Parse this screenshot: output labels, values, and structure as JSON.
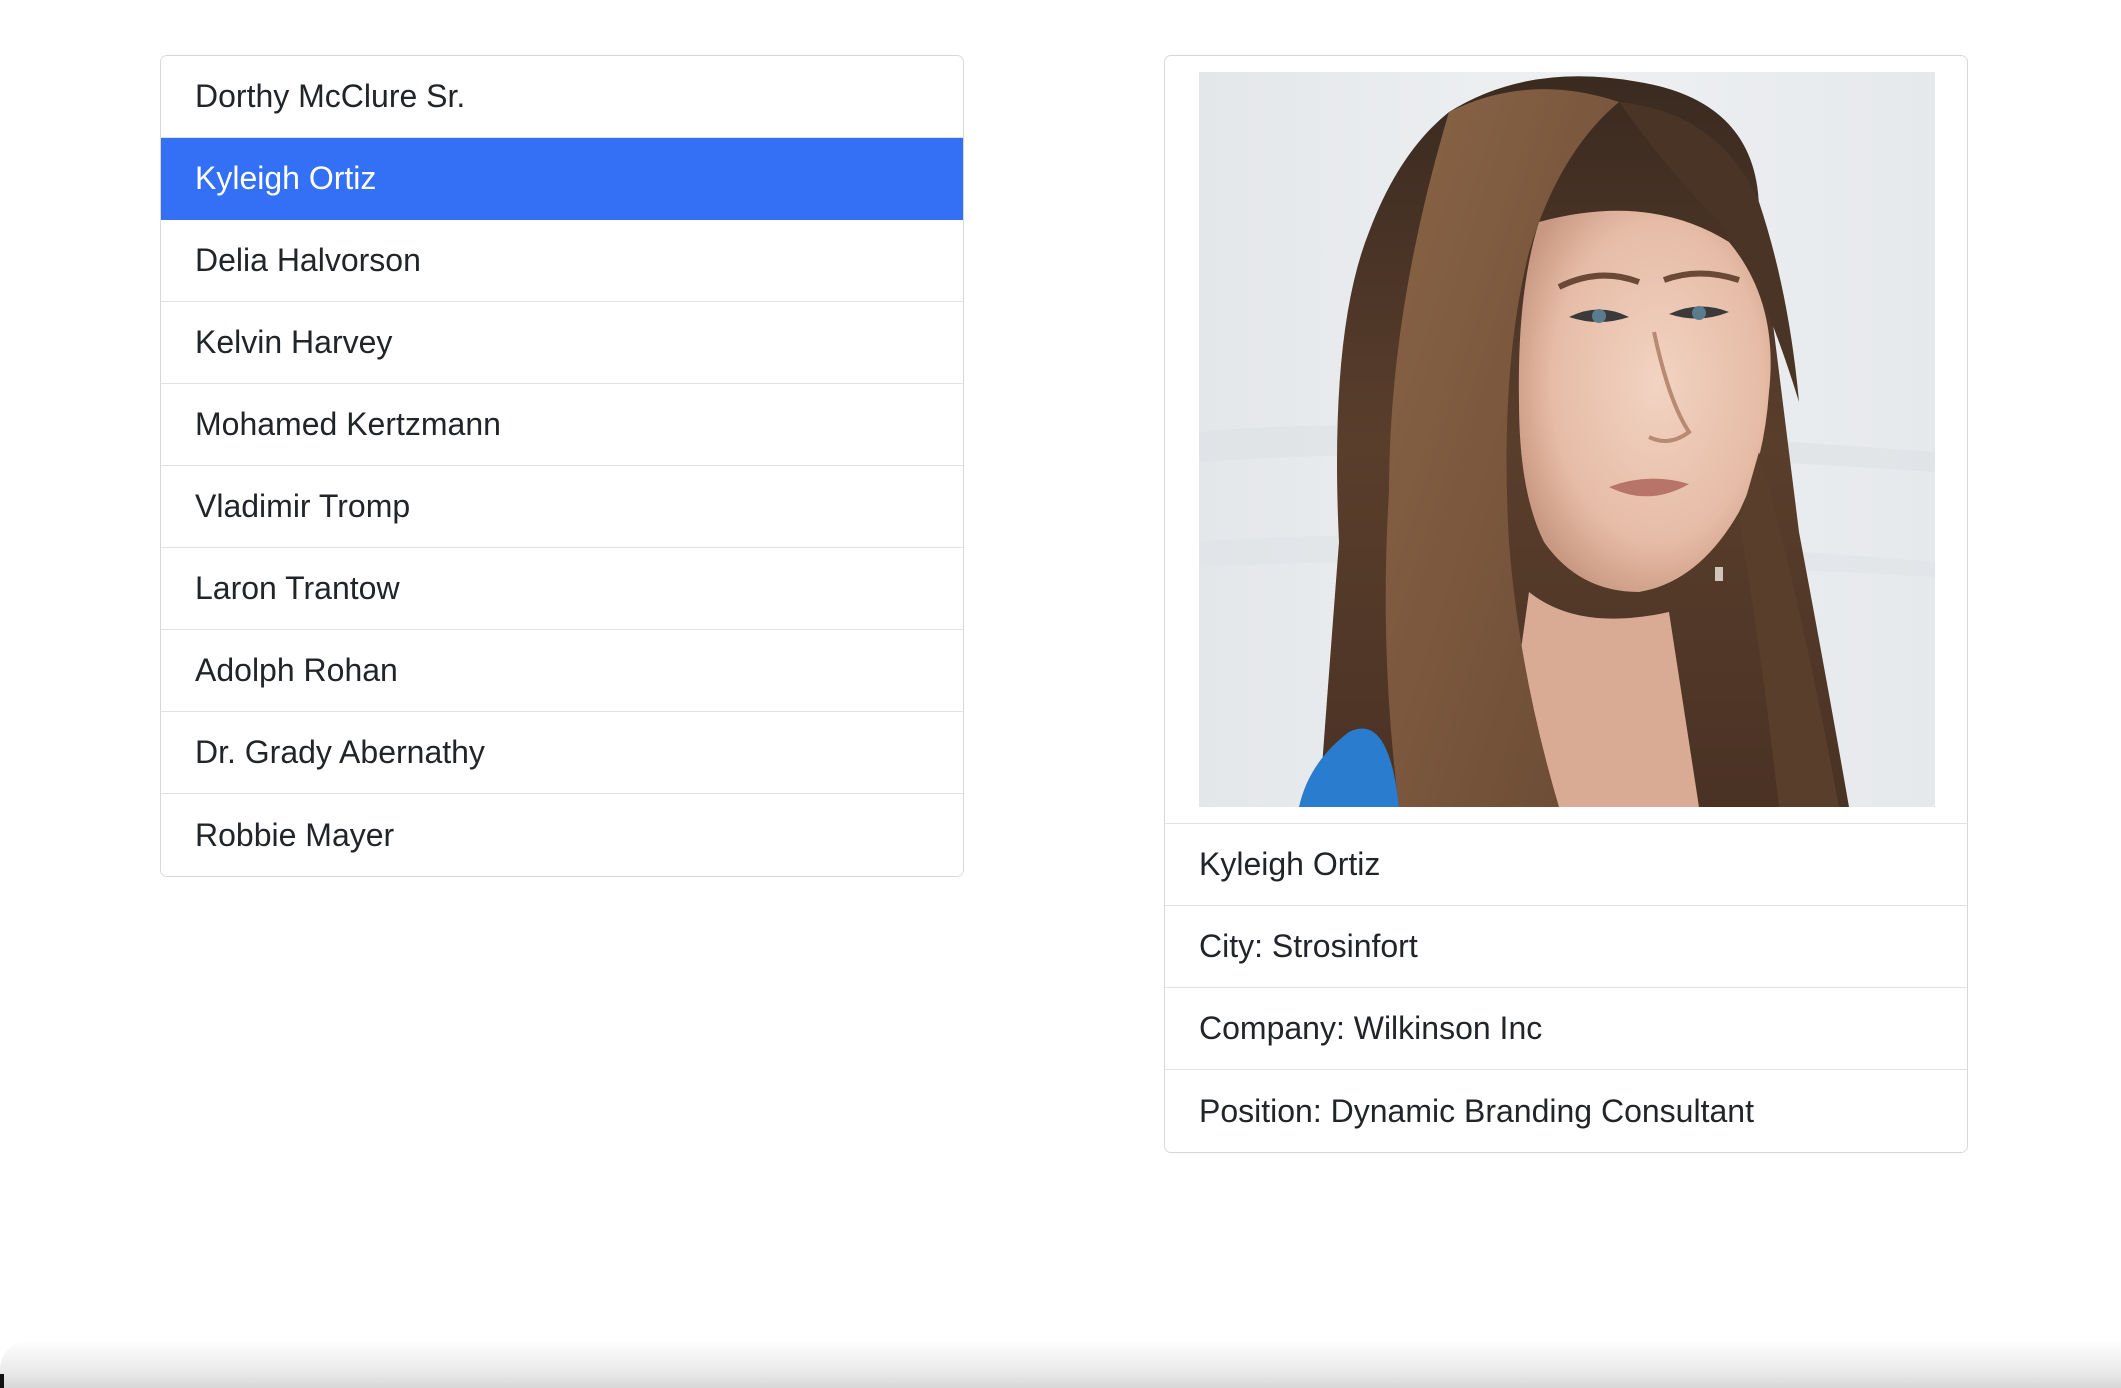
{
  "people_list": {
    "items": [
      {
        "label": "Dorthy McClure Sr.",
        "active": false
      },
      {
        "label": "Kyleigh Ortiz",
        "active": true
      },
      {
        "label": "Delia Halvorson",
        "active": false
      },
      {
        "label": "Kelvin Harvey",
        "active": false
      },
      {
        "label": "Mohamed Kertzmann",
        "active": false
      },
      {
        "label": "Vladimir Tromp",
        "active": false
      },
      {
        "label": "Laron Trantow",
        "active": false
      },
      {
        "label": "Adolph Rohan",
        "active": false
      },
      {
        "label": "Dr. Grady Abernathy",
        "active": false
      },
      {
        "label": "Robbie Mayer",
        "active": false
      }
    ],
    "active_color": "#3470f6"
  },
  "detail": {
    "name": "Kyleigh Ortiz",
    "city": "City: Strosinfort",
    "company": "Company: Wilkinson Inc",
    "position": "Position: Dynamic Branding Consultant",
    "photo_icon": "person-photo"
  }
}
